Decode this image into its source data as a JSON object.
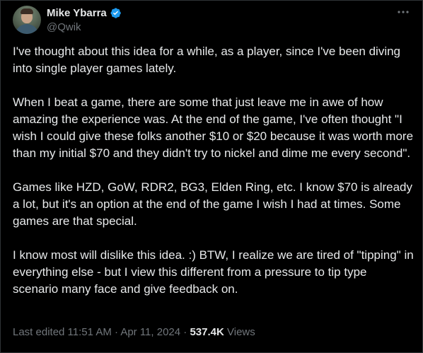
{
  "colors": {
    "background": "#000000",
    "text_primary": "#e7e9ea",
    "text_secondary": "#71767b",
    "verified_badge": "#1d9bf0",
    "border": "#2f3336"
  },
  "author": {
    "name": "Mike Ybarra",
    "handle": "@Qwik",
    "avatar_icon": "avatar-photo",
    "verified_icon": "verified-badge-icon"
  },
  "menu": {
    "icon": "more-horizontal-icon"
  },
  "tweet": {
    "paragraphs": [
      "I've thought about this idea for a while, as a player, since I've been diving into single player games lately.",
      "When I beat a game, there are some that just leave me in awe of how amazing the experience was. At the end of the game, I've often thought \"I wish I could give these folks another $10 or $20 because it was worth more than my initial $70 and they didn't try to nickel and dime me every second\".",
      "Games like HZD, GoW, RDR2, BG3, Elden Ring, etc. I know $70 is already a lot, but it's an option at the end of the game I wish I had at times. Some games are that special.",
      "I know most will dislike this idea.  :) BTW, I realize we are tired of \"tipping\" in everything else - but I view this different from a pressure to tip type scenario many face and give feedback on."
    ]
  },
  "meta": {
    "edited_label": "Last edited 11:51 AM · Apr 11, 2024",
    "separator": "·",
    "views_count": "537.4K",
    "views_label": "Views"
  }
}
